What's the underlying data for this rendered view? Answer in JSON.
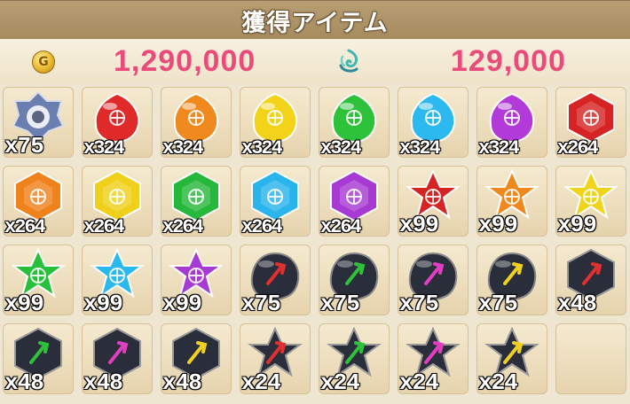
{
  "header": {
    "title": "獲得アイテム"
  },
  "currency": {
    "gold": {
      "icon": "gold-coin-icon",
      "symbol": "G",
      "amount": "1,290,000"
    },
    "spirit": {
      "icon": "spirit-swirl-icon",
      "amount": "129,000"
    }
  },
  "items": [
    {
      "shape": "crest",
      "color": "#6a7fb0",
      "qty": "x75"
    },
    {
      "shape": "drop",
      "color": "#e02a2a",
      "qty": "x324"
    },
    {
      "shape": "drop",
      "color": "#f08a1e",
      "qty": "x324"
    },
    {
      "shape": "drop",
      "color": "#f2d31a",
      "qty": "x324"
    },
    {
      "shape": "drop",
      "color": "#2ec23a",
      "qty": "x324"
    },
    {
      "shape": "drop",
      "color": "#2cb9f0",
      "qty": "x324"
    },
    {
      "shape": "drop",
      "color": "#b23ad8",
      "qty": "x324"
    },
    {
      "shape": "hex",
      "color": "#d62424",
      "qty": "x264"
    },
    {
      "shape": "hex",
      "color": "#f0821c",
      "qty": "x264"
    },
    {
      "shape": "hex",
      "color": "#f0d01a",
      "qty": "x264"
    },
    {
      "shape": "hex",
      "color": "#26b83a",
      "qty": "x264"
    },
    {
      "shape": "hex",
      "color": "#2ab4ec",
      "qty": "x264"
    },
    {
      "shape": "hex",
      "color": "#a83ad4",
      "qty": "x264"
    },
    {
      "shape": "star",
      "color": "#d62424",
      "qty": "x99"
    },
    {
      "shape": "star",
      "color": "#f0881c",
      "qty": "x99"
    },
    {
      "shape": "star",
      "color": "#f0d41a",
      "qty": "x99"
    },
    {
      "shape": "star",
      "color": "#26c03a",
      "qty": "x99"
    },
    {
      "shape": "star",
      "color": "#2ab8ee",
      "qty": "x99"
    },
    {
      "shape": "star",
      "color": "#a83ad4",
      "qty": "x99"
    },
    {
      "shape": "blob",
      "color": "#2a2d3a",
      "accent": "#e03030",
      "qty": "x75"
    },
    {
      "shape": "blob",
      "color": "#2a2d3a",
      "accent": "#2ec23a",
      "qty": "x75"
    },
    {
      "shape": "blob",
      "color": "#2a2d3a",
      "accent": "#e040c0",
      "qty": "x75"
    },
    {
      "shape": "blob",
      "color": "#2a2d3a",
      "accent": "#f0d020",
      "qty": "x75"
    },
    {
      "shape": "darkhex",
      "color": "#2a2d3a",
      "accent": "#e03030",
      "qty": "x48"
    },
    {
      "shape": "darkhex",
      "color": "#2a2d3a",
      "accent": "#2ec23a",
      "qty": "x48"
    },
    {
      "shape": "darkhex",
      "color": "#2a2d3a",
      "accent": "#e040c0",
      "qty": "x48"
    },
    {
      "shape": "darkhex",
      "color": "#2a2d3a",
      "accent": "#f0d020",
      "qty": "x48"
    },
    {
      "shape": "darkstar",
      "color": "#2a2d3a",
      "accent": "#e03030",
      "qty": "x24"
    },
    {
      "shape": "darkstar",
      "color": "#2a2d3a",
      "accent": "#2ec23a",
      "qty": "x24"
    },
    {
      "shape": "darkstar",
      "color": "#2a2d3a",
      "accent": "#e040c0",
      "qty": "x24"
    },
    {
      "shape": "darkstar",
      "color": "#2a2d3a",
      "accent": "#f0d020",
      "qty": "x24"
    },
    {
      "shape": "empty",
      "qty": ""
    }
  ]
}
